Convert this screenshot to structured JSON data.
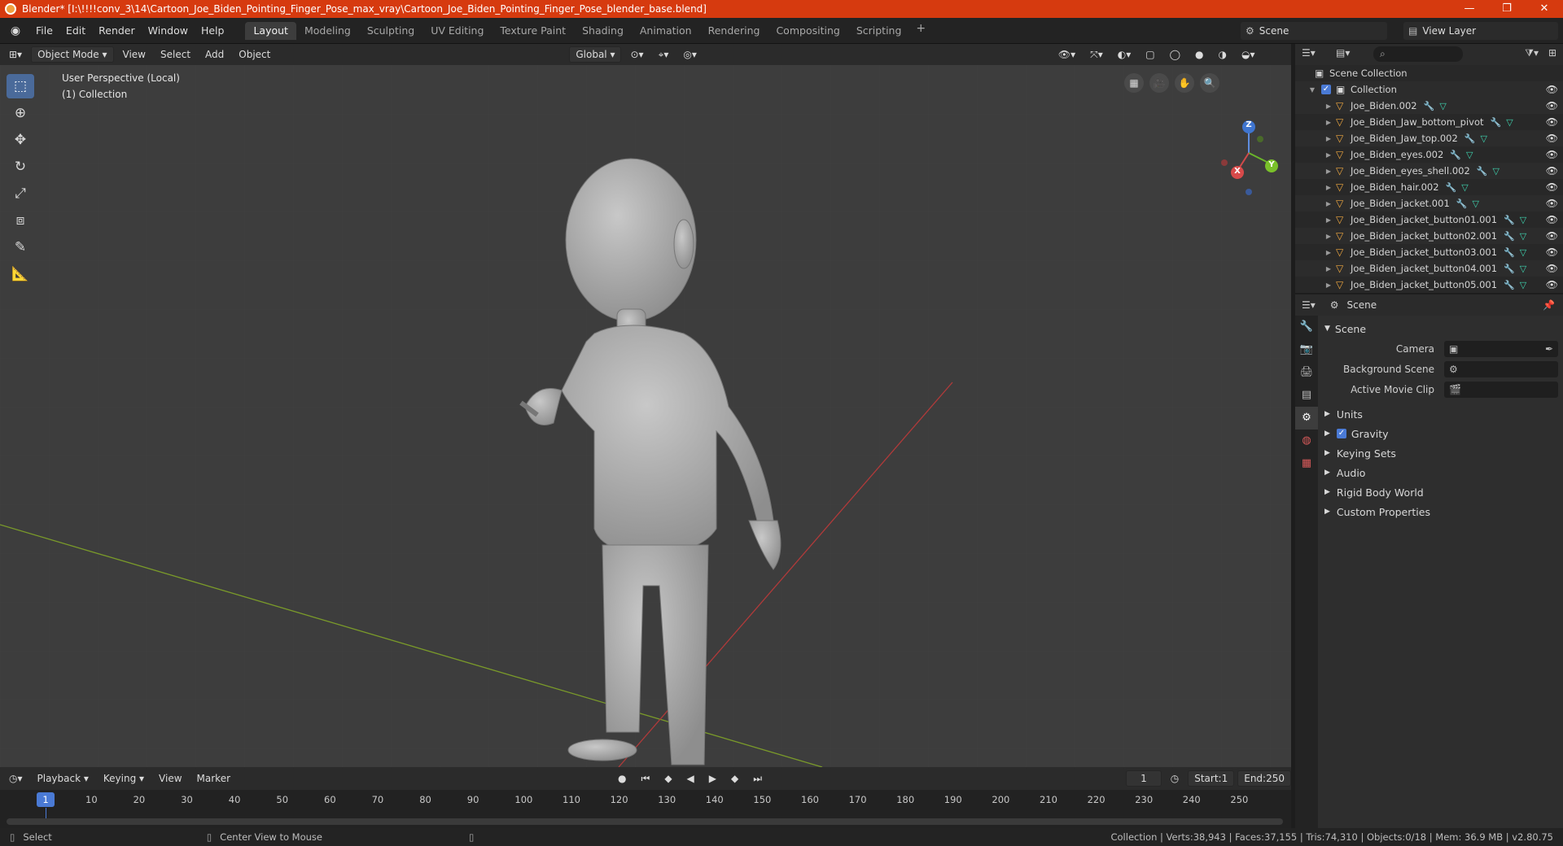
{
  "window": {
    "title": "Blender* [I:\\!!!!conv_3\\14\\Cartoon_Joe_Biden_Pointing_Finger_Pose_max_vray\\Cartoon_Joe_Biden_Pointing_Finger_Pose_blender_base.blend]",
    "minimize": "—",
    "maximize": "❐",
    "close": "✕"
  },
  "menus": [
    "File",
    "Edit",
    "Render",
    "Window",
    "Help"
  ],
  "workspaces": [
    "Layout",
    "Modeling",
    "Sculpting",
    "UV Editing",
    "Texture Paint",
    "Shading",
    "Animation",
    "Rendering",
    "Compositing",
    "Scripting"
  ],
  "active_workspace": "Layout",
  "scene_selector": {
    "label": "Scene"
  },
  "view_layer_selector": {
    "label": "View Layer"
  },
  "viewport_header": {
    "mode": "Object Mode",
    "menus": [
      "View",
      "Select",
      "Add",
      "Object"
    ],
    "transform_orientation": "Global"
  },
  "viewport": {
    "perspective_label": "User Perspective (Local)",
    "collection_label": "(1) Collection",
    "gizmo_axes": [
      "Z",
      "Y",
      "X"
    ]
  },
  "outliner": {
    "root": "Scene Collection",
    "collection": "Collection",
    "objects": [
      "Joe_Biden.002",
      "Joe_Biden_Jaw_bottom_pivot",
      "Joe_Biden_Jaw_top.002",
      "Joe_Biden_eyes.002",
      "Joe_Biden_eyes_shell.002",
      "Joe_Biden_hair.002",
      "Joe_Biden_jacket.001",
      "Joe_Biden_jacket_button01.001",
      "Joe_Biden_jacket_button02.001",
      "Joe_Biden_jacket_button03.001",
      "Joe_Biden_jacket_button04.001",
      "Joe_Biden_jacket_button05.001"
    ]
  },
  "properties": {
    "header_title": "Scene",
    "panel_title": "Scene",
    "fields": [
      {
        "label": "Camera",
        "value": ""
      },
      {
        "label": "Background Scene",
        "value": ""
      },
      {
        "label": "Active Movie Clip",
        "value": ""
      }
    ],
    "sections": [
      "Units",
      "Gravity",
      "Keying Sets",
      "Audio",
      "Rigid Body World",
      "Custom Properties"
    ],
    "gravity_checked": true
  },
  "timeline": {
    "menus": [
      "Playback",
      "Keying",
      "View",
      "Marker"
    ],
    "current_frame": "1",
    "start_label": "Start:",
    "start": "1",
    "end_label": "End:",
    "end": "250",
    "ruler": [
      "10",
      "20",
      "30",
      "40",
      "50",
      "60",
      "70",
      "80",
      "90",
      "100",
      "110",
      "120",
      "130",
      "140",
      "150",
      "160",
      "170",
      "180",
      "190",
      "200",
      "210",
      "220",
      "230",
      "240",
      "250"
    ]
  },
  "statusbar": {
    "left": "Select",
    "middle": "Center View to Mouse",
    "right": "Collection | Verts:38,943 | Faces:37,155 | Tris:74,310 | Objects:0/18 | Mem: 36.9 MB | v2.80.75"
  }
}
